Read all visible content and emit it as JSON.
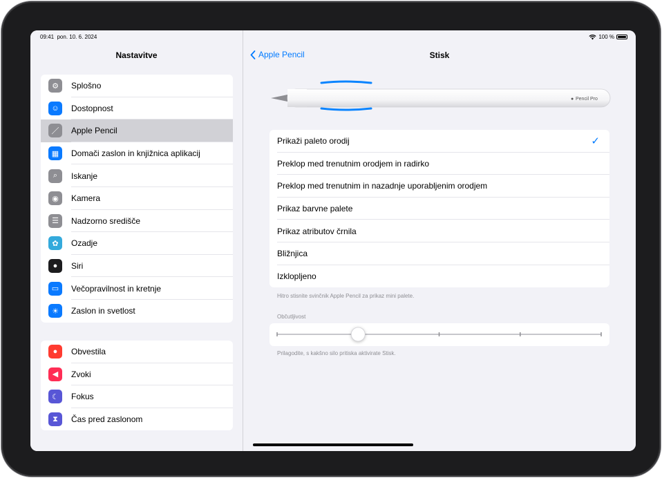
{
  "status": {
    "time": "09:41",
    "date": "pon. 10. 6. 2024",
    "battery": "100 %"
  },
  "sidebar": {
    "title": "Nastavitve",
    "group1": [
      {
        "label": "Splošno",
        "icon": "gear-icon",
        "color": "#8e8e93"
      },
      {
        "label": "Dostopnost",
        "icon": "accessibility-icon",
        "color": "#0a7aff"
      },
      {
        "label": "Apple Pencil",
        "icon": "pencil-icon",
        "color": "#8e8e93",
        "selected": true
      },
      {
        "label": "Domači zaslon in knjižnica aplikacij",
        "icon": "home-screen-icon",
        "color": "#0a7aff"
      },
      {
        "label": "Iskanje",
        "icon": "search-icon",
        "color": "#8e8e93"
      },
      {
        "label": "Kamera",
        "icon": "camera-icon",
        "color": "#8e8e93"
      },
      {
        "label": "Nadzorno središče",
        "icon": "control-center-icon",
        "color": "#8e8e93"
      },
      {
        "label": "Ozadje",
        "icon": "wallpaper-icon",
        "color": "#34aadc"
      },
      {
        "label": "Siri",
        "icon": "siri-icon",
        "color": "#1c1c1e"
      },
      {
        "label": "Večopravilnost in kretnje",
        "icon": "multitasking-icon",
        "color": "#0a7aff"
      },
      {
        "label": "Zaslon in svetlost",
        "icon": "brightness-icon",
        "color": "#0a7aff"
      }
    ],
    "group2": [
      {
        "label": "Obvestila",
        "icon": "notifications-icon",
        "color": "#ff3b30"
      },
      {
        "label": "Zvoki",
        "icon": "sounds-icon",
        "color": "#ff2d55"
      },
      {
        "label": "Fokus",
        "icon": "focus-icon",
        "color": "#5856d6"
      },
      {
        "label": "Čas pred zaslonom",
        "icon": "screen-time-icon",
        "color": "#5856d6"
      }
    ]
  },
  "detail": {
    "back_label": "Apple Pencil",
    "title": "Stisk",
    "pencil_brand": "Pencil Pro",
    "options": [
      {
        "label": "Prikaži paleto orodij",
        "checked": true
      },
      {
        "label": "Preklop med trenutnim orodjem in radirko"
      },
      {
        "label": "Preklop med trenutnim in nazadnje uporabljenim orodjem"
      },
      {
        "label": "Prikaz barvne palete"
      },
      {
        "label": "Prikaz atributov črnila"
      },
      {
        "label": "Bližnjica"
      },
      {
        "label": "Izklopljeno"
      }
    ],
    "options_footer": "Hitro stisnite svinčnik Apple Pencil za prikaz mini palete.",
    "sensitivity_header": "Občutljivost",
    "sensitivity_value": 0.25,
    "sensitivity_footer": "Prilagodite, s kakšno silo pritiska aktivirate Stisk."
  }
}
